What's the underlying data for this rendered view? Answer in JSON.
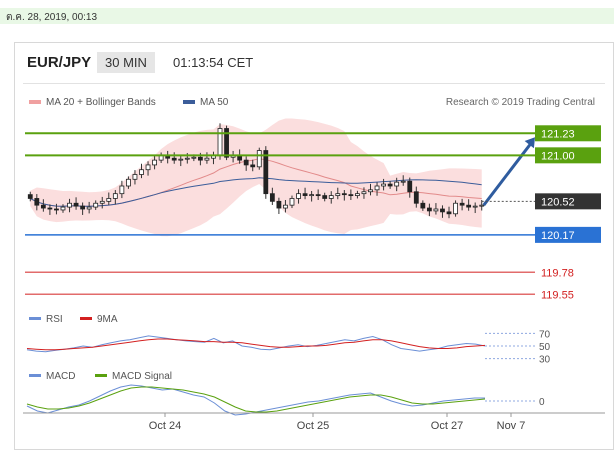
{
  "date_label": "ต.ค. 28, 2019, 00:13",
  "header": {
    "pair": "EUR/JPY",
    "timeframe": "30 MIN",
    "clock": "01:13:54 CET"
  },
  "legend": {
    "bollinger": "MA 20 + Bollinger Bands",
    "ma50": "MA 50"
  },
  "credit": "Research © 2019 Trading Central",
  "colors": {
    "up_line": "#5aa10f",
    "down_line": "#2a72d4",
    "red_line": "#e26b6b",
    "last_price": "#333333",
    "ma50": "#3b5d9a",
    "arrow": "#2f5c9f"
  },
  "chart_data": [
    {
      "type": "candlestick",
      "title": "EUR/JPY",
      "timeframe": "30 MIN",
      "y_range": [
        119.48,
        121.4
      ],
      "x_tick_labels": [
        "Oct 24",
        "Oct 25",
        "Oct 27",
        "Nov 7"
      ],
      "closes": [
        120.55,
        120.48,
        120.45,
        120.44,
        120.43,
        120.46,
        120.5,
        120.47,
        120.44,
        120.46,
        120.5,
        120.52,
        120.55,
        120.6,
        120.68,
        120.75,
        120.8,
        120.85,
        120.9,
        120.95,
        121.0,
        120.97,
        120.95,
        120.96,
        120.97,
        120.98,
        120.95,
        120.97,
        121.0,
        121.28,
        120.98,
        121.0,
        120.95,
        120.9,
        120.88,
        121.05,
        120.6,
        120.52,
        120.45,
        120.48,
        120.55,
        120.6,
        120.58,
        120.59,
        120.58,
        120.55,
        120.58,
        120.6,
        120.59,
        120.58,
        120.6,
        120.62,
        120.64,
        120.68,
        120.7,
        120.68,
        120.72,
        120.73,
        120.62,
        120.5,
        120.45,
        120.42,
        120.44,
        120.41,
        120.39,
        120.5,
        120.48,
        120.46,
        120.47,
        120.48
      ],
      "levels": [
        {
          "value": 121.23,
          "label": "121.23",
          "kind": "resistance"
        },
        {
          "value": 121.0,
          "label": "121.00",
          "kind": "resistance"
        },
        {
          "value": 120.52,
          "label": "120.52",
          "kind": "last"
        },
        {
          "value": 120.17,
          "label": "120.17",
          "kind": "pivot"
        },
        {
          "value": 119.78,
          "label": "119.78",
          "kind": "support"
        },
        {
          "value": 119.55,
          "label": "119.55",
          "kind": "support"
        }
      ],
      "series": [
        {
          "name": "MA 20 + Bollinger Bands",
          "color": "#e28a8a"
        },
        {
          "name": "MA 50",
          "color": "#3b5d9a"
        }
      ]
    },
    {
      "type": "line",
      "title": "RSI",
      "y_ticks": [
        70,
        50,
        30
      ],
      "series": [
        {
          "name": "RSI",
          "color": "#6b8fd6",
          "values": [
            44,
            42,
            41,
            43,
            45,
            47,
            50,
            48,
            52,
            55,
            58,
            60,
            63,
            66,
            64,
            62,
            60,
            58,
            57,
            56,
            62,
            55,
            58,
            50,
            48,
            45,
            44,
            47,
            50,
            52,
            49,
            51,
            54,
            57,
            60,
            58,
            62,
            65,
            60,
            52,
            46,
            44,
            42,
            44,
            46,
            50,
            52,
            54,
            53,
            50
          ]
        },
        {
          "name": "9MA",
          "color": "#d32020",
          "values": [
            46,
            45,
            44,
            44,
            45,
            46,
            47,
            48,
            50,
            52,
            54,
            56,
            58,
            60,
            61,
            61,
            60,
            59,
            58,
            57,
            57,
            56,
            56,
            55,
            53,
            51,
            49,
            48,
            48,
            49,
            50,
            50,
            51,
            53,
            55,
            56,
            58,
            60,
            60,
            58,
            55,
            52,
            49,
            47,
            46,
            46,
            47,
            49,
            50,
            51
          ]
        }
      ]
    },
    {
      "type": "line",
      "title": "MACD",
      "y_ticks": [
        0
      ],
      "series": [
        {
          "name": "MACD",
          "color": "#6b8fd6",
          "values": [
            -5,
            -10,
            -12,
            -9,
            -6,
            -4,
            0,
            5,
            10,
            14,
            16,
            15,
            13,
            11,
            12,
            9,
            6,
            4,
            -2,
            -10,
            -14,
            -13,
            -11,
            -9,
            -7,
            -5,
            -3,
            -1,
            0,
            2,
            4,
            6,
            7,
            8,
            4,
            0,
            -3,
            -5,
            -4,
            -2,
            0,
            1,
            2,
            3,
            3
          ]
        },
        {
          "name": "MACD Signal",
          "color": "#5aa10f",
          "values": [
            -3,
            -6,
            -8,
            -8,
            -7,
            -5,
            -2,
            2,
            6,
            10,
            13,
            14,
            14,
            13,
            12,
            11,
            9,
            7,
            4,
            -1,
            -6,
            -10,
            -11,
            -11,
            -10,
            -8,
            -6,
            -4,
            -2,
            0,
            2,
            4,
            5,
            6,
            6,
            4,
            1,
            -2,
            -3,
            -3,
            -2,
            -1,
            0,
            1,
            2
          ]
        }
      ]
    }
  ]
}
